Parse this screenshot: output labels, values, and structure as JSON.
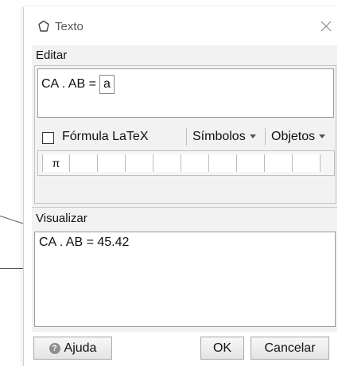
{
  "dialog": {
    "title": "Texto",
    "title_icon": "shapes-icon",
    "close_icon": "close-icon"
  },
  "edit": {
    "label": "Editar",
    "expression_prefix": "CA . AB =",
    "variable": "a"
  },
  "options": {
    "latex_label": "Fórmula LaTeX",
    "latex_checked": false,
    "symbols_label": "Símbolos",
    "objects_label": "Objetos"
  },
  "symbols": [
    "π",
    "",
    "",
    "",
    "",
    "",
    "",
    "",
    "",
    ""
  ],
  "preview": {
    "label": "Visualizar",
    "text": "CA . AB = 45.42"
  },
  "footer": {
    "help_label": "Ajuda",
    "help_icon": "question-icon",
    "ok_label": "OK",
    "cancel_label": "Cancelar"
  }
}
